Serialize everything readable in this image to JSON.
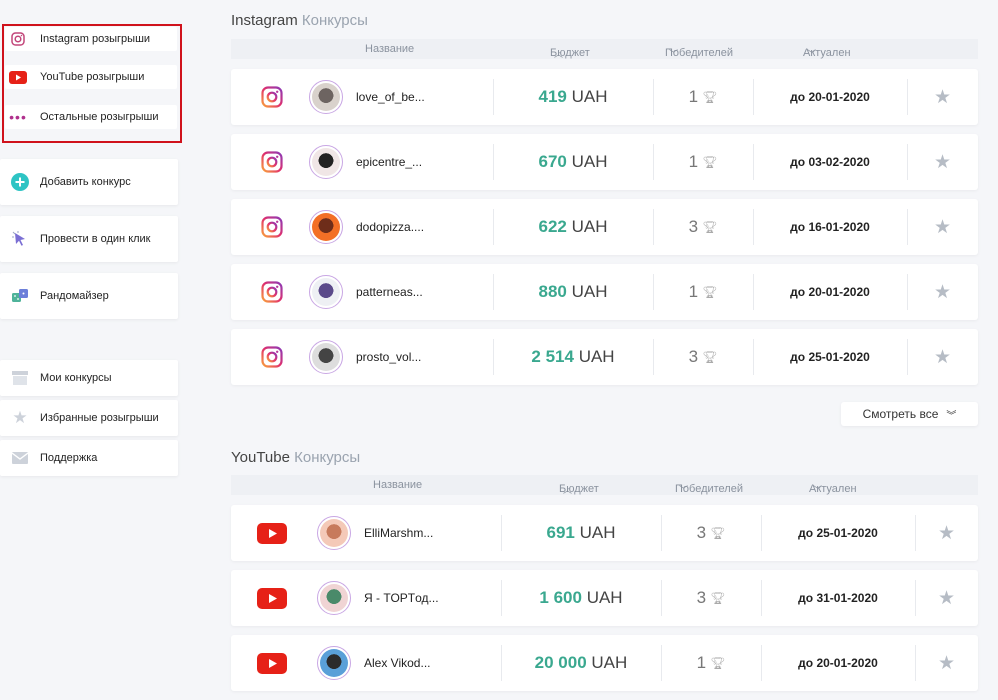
{
  "sidebar": {
    "top": [
      {
        "label": "Instagram розыгрыши",
        "icon": "instagram-icon"
      },
      {
        "label": "YouTube розыгрыши",
        "icon": "youtube-icon"
      },
      {
        "label": "Остальные розыгрыши",
        "icon": "dots-icon"
      }
    ],
    "actions": [
      {
        "label": "Добавить конкурс",
        "icon": "plus-circle-icon"
      },
      {
        "label": "Провести в один клик",
        "icon": "cursor-click-icon"
      },
      {
        "label": "Рандомайзер",
        "icon": "dice-icon"
      }
    ],
    "bottom": [
      {
        "label": "Мои конкурсы",
        "icon": "archive-icon"
      },
      {
        "label": "Избранные розыгрыши",
        "icon": "star-icon"
      },
      {
        "label": "Поддержка",
        "icon": "mail-icon"
      }
    ]
  },
  "instagram": {
    "title": "Instagram",
    "title_sub": "Конкурсы",
    "headers": {
      "name": "Название",
      "budget": "Бюджет",
      "winners": "Победителей",
      "actual": "Актуален"
    },
    "rows": [
      {
        "name": "love_of_be...",
        "amount": "419",
        "currency": "UAH",
        "winners": "1",
        "date": "до 20-01-2020"
      },
      {
        "name": "epicentre_...",
        "amount": "670",
        "currency": "UAH",
        "winners": "1",
        "date": "до 03-02-2020"
      },
      {
        "name": "dodopizza....",
        "amount": "622",
        "currency": "UAH",
        "winners": "3",
        "date": "до 16-01-2020"
      },
      {
        "name": "patterneas...",
        "amount": "880",
        "currency": "UAH",
        "winners": "1",
        "date": "до 20-01-2020"
      },
      {
        "name": "prosto_vol...",
        "amount": "2 514",
        "currency": "UAH",
        "winners": "3",
        "date": "до 25-01-2020"
      }
    ],
    "see_all": "Смотреть все"
  },
  "youtube": {
    "title": "YouTube",
    "title_sub": "Конкурсы",
    "headers": {
      "name": "Название",
      "budget": "Бюджет",
      "winners": "Победителей",
      "actual": "Актуален"
    },
    "rows": [
      {
        "name": "ElliMarshm...",
        "amount": "691",
        "currency": "UAH",
        "winners": "3",
        "date": "до 25-01-2020"
      },
      {
        "name": "Я - TOPTод...",
        "amount": "1 600",
        "currency": "UAH",
        "winners": "3",
        "date": "до 31-01-2020"
      },
      {
        "name": "Alex Vikod...",
        "amount": "20 000",
        "currency": "UAH",
        "winners": "1",
        "date": "до 20-01-2020"
      }
    ]
  },
  "colors": {
    "accent": "#3aa88f",
    "highlight_border": "#d0121c",
    "youtube_red": "#e62117"
  }
}
